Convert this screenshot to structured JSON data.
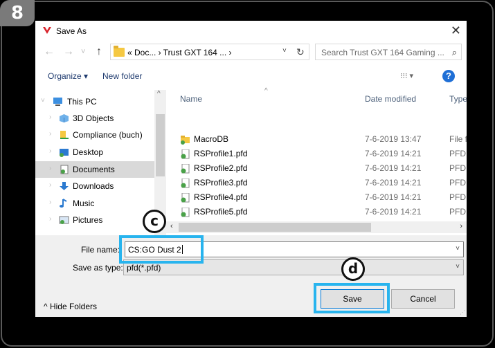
{
  "step_badge": "8",
  "dialog": {
    "title": "Save As",
    "close_glyph": "✕",
    "title_icon": "trust-logo-icon"
  },
  "nav": {
    "back_glyph": "←",
    "forward_glyph": "→",
    "recent_glyph": "˅",
    "up_glyph": "↑",
    "address": "«  Doc...  ›  Trust GXT 164 ...  ›",
    "address_dropdown": "˅",
    "refresh_glyph": "↻",
    "search_placeholder": "Search Trust GXT 164 Gaming ...",
    "search_glyph": "⌕"
  },
  "toolbar": {
    "organize": "Organize ▾",
    "new_folder": "New folder",
    "view": "⁝⁝⁝  ▾",
    "help": "?"
  },
  "sidebar": {
    "items": [
      {
        "label": "This PC",
        "icon": "computer-icon",
        "color": "#3c8fe0"
      },
      {
        "label": "3D Objects",
        "icon": "cube-icon",
        "color": "#6fb1ea"
      },
      {
        "label": "Compliance (buch)",
        "icon": "folder-icon",
        "color": "#f5c842"
      },
      {
        "label": "Desktop",
        "icon": "desktop-icon",
        "color": "#2b7ad0"
      },
      {
        "label": "Documents",
        "icon": "documents-icon",
        "color": "#4aa148"
      },
      {
        "label": "Downloads",
        "icon": "download-icon",
        "color": "#2b7ad0"
      },
      {
        "label": "Music",
        "icon": "music-icon",
        "color": "#2b7ad0"
      },
      {
        "label": "Pictures",
        "icon": "pictures-icon",
        "color": "#4aa148"
      }
    ],
    "selected_index": 4,
    "chevron": "›",
    "scroll_up": "^"
  },
  "file_list": {
    "columns": [
      "Name",
      "Date modified",
      "Type"
    ],
    "rows": [
      {
        "name": "MacroDB",
        "date": "7-6-2019 13:47",
        "type": "File f",
        "icon": "folder-icon"
      },
      {
        "name": "RSProfile1.pfd",
        "date": "7-6-2019 14:21",
        "type": "PFD",
        "icon": "file-icon"
      },
      {
        "name": "RSProfile2.pfd",
        "date": "7-6-2019 14:21",
        "type": "PFD",
        "icon": "file-icon"
      },
      {
        "name": "RSProfile3.pfd",
        "date": "7-6-2019 14:21",
        "type": "PFD",
        "icon": "file-icon"
      },
      {
        "name": "RSProfile4.pfd",
        "date": "7-6-2019 14:21",
        "type": "PFD",
        "icon": "file-icon"
      },
      {
        "name": "RSProfile5.pfd",
        "date": "7-6-2019 14:21",
        "type": "PFD",
        "icon": "file-icon"
      }
    ],
    "scroll_left": "‹",
    "scroll_right": "›"
  },
  "form": {
    "file_name_label": "File name:",
    "file_name_value": "CS:GO Dust 2",
    "save_type_label": "Save as type:",
    "save_type_value": "pfd(*.pfd)",
    "dropdown_glyph": "˅"
  },
  "footer": {
    "hide_folders": "^   Hide Folders",
    "save": "Save",
    "cancel": "Cancel"
  },
  "annotations": {
    "callout_c": "c",
    "callout_d": "d",
    "highlight_color": "#28b4ee"
  }
}
